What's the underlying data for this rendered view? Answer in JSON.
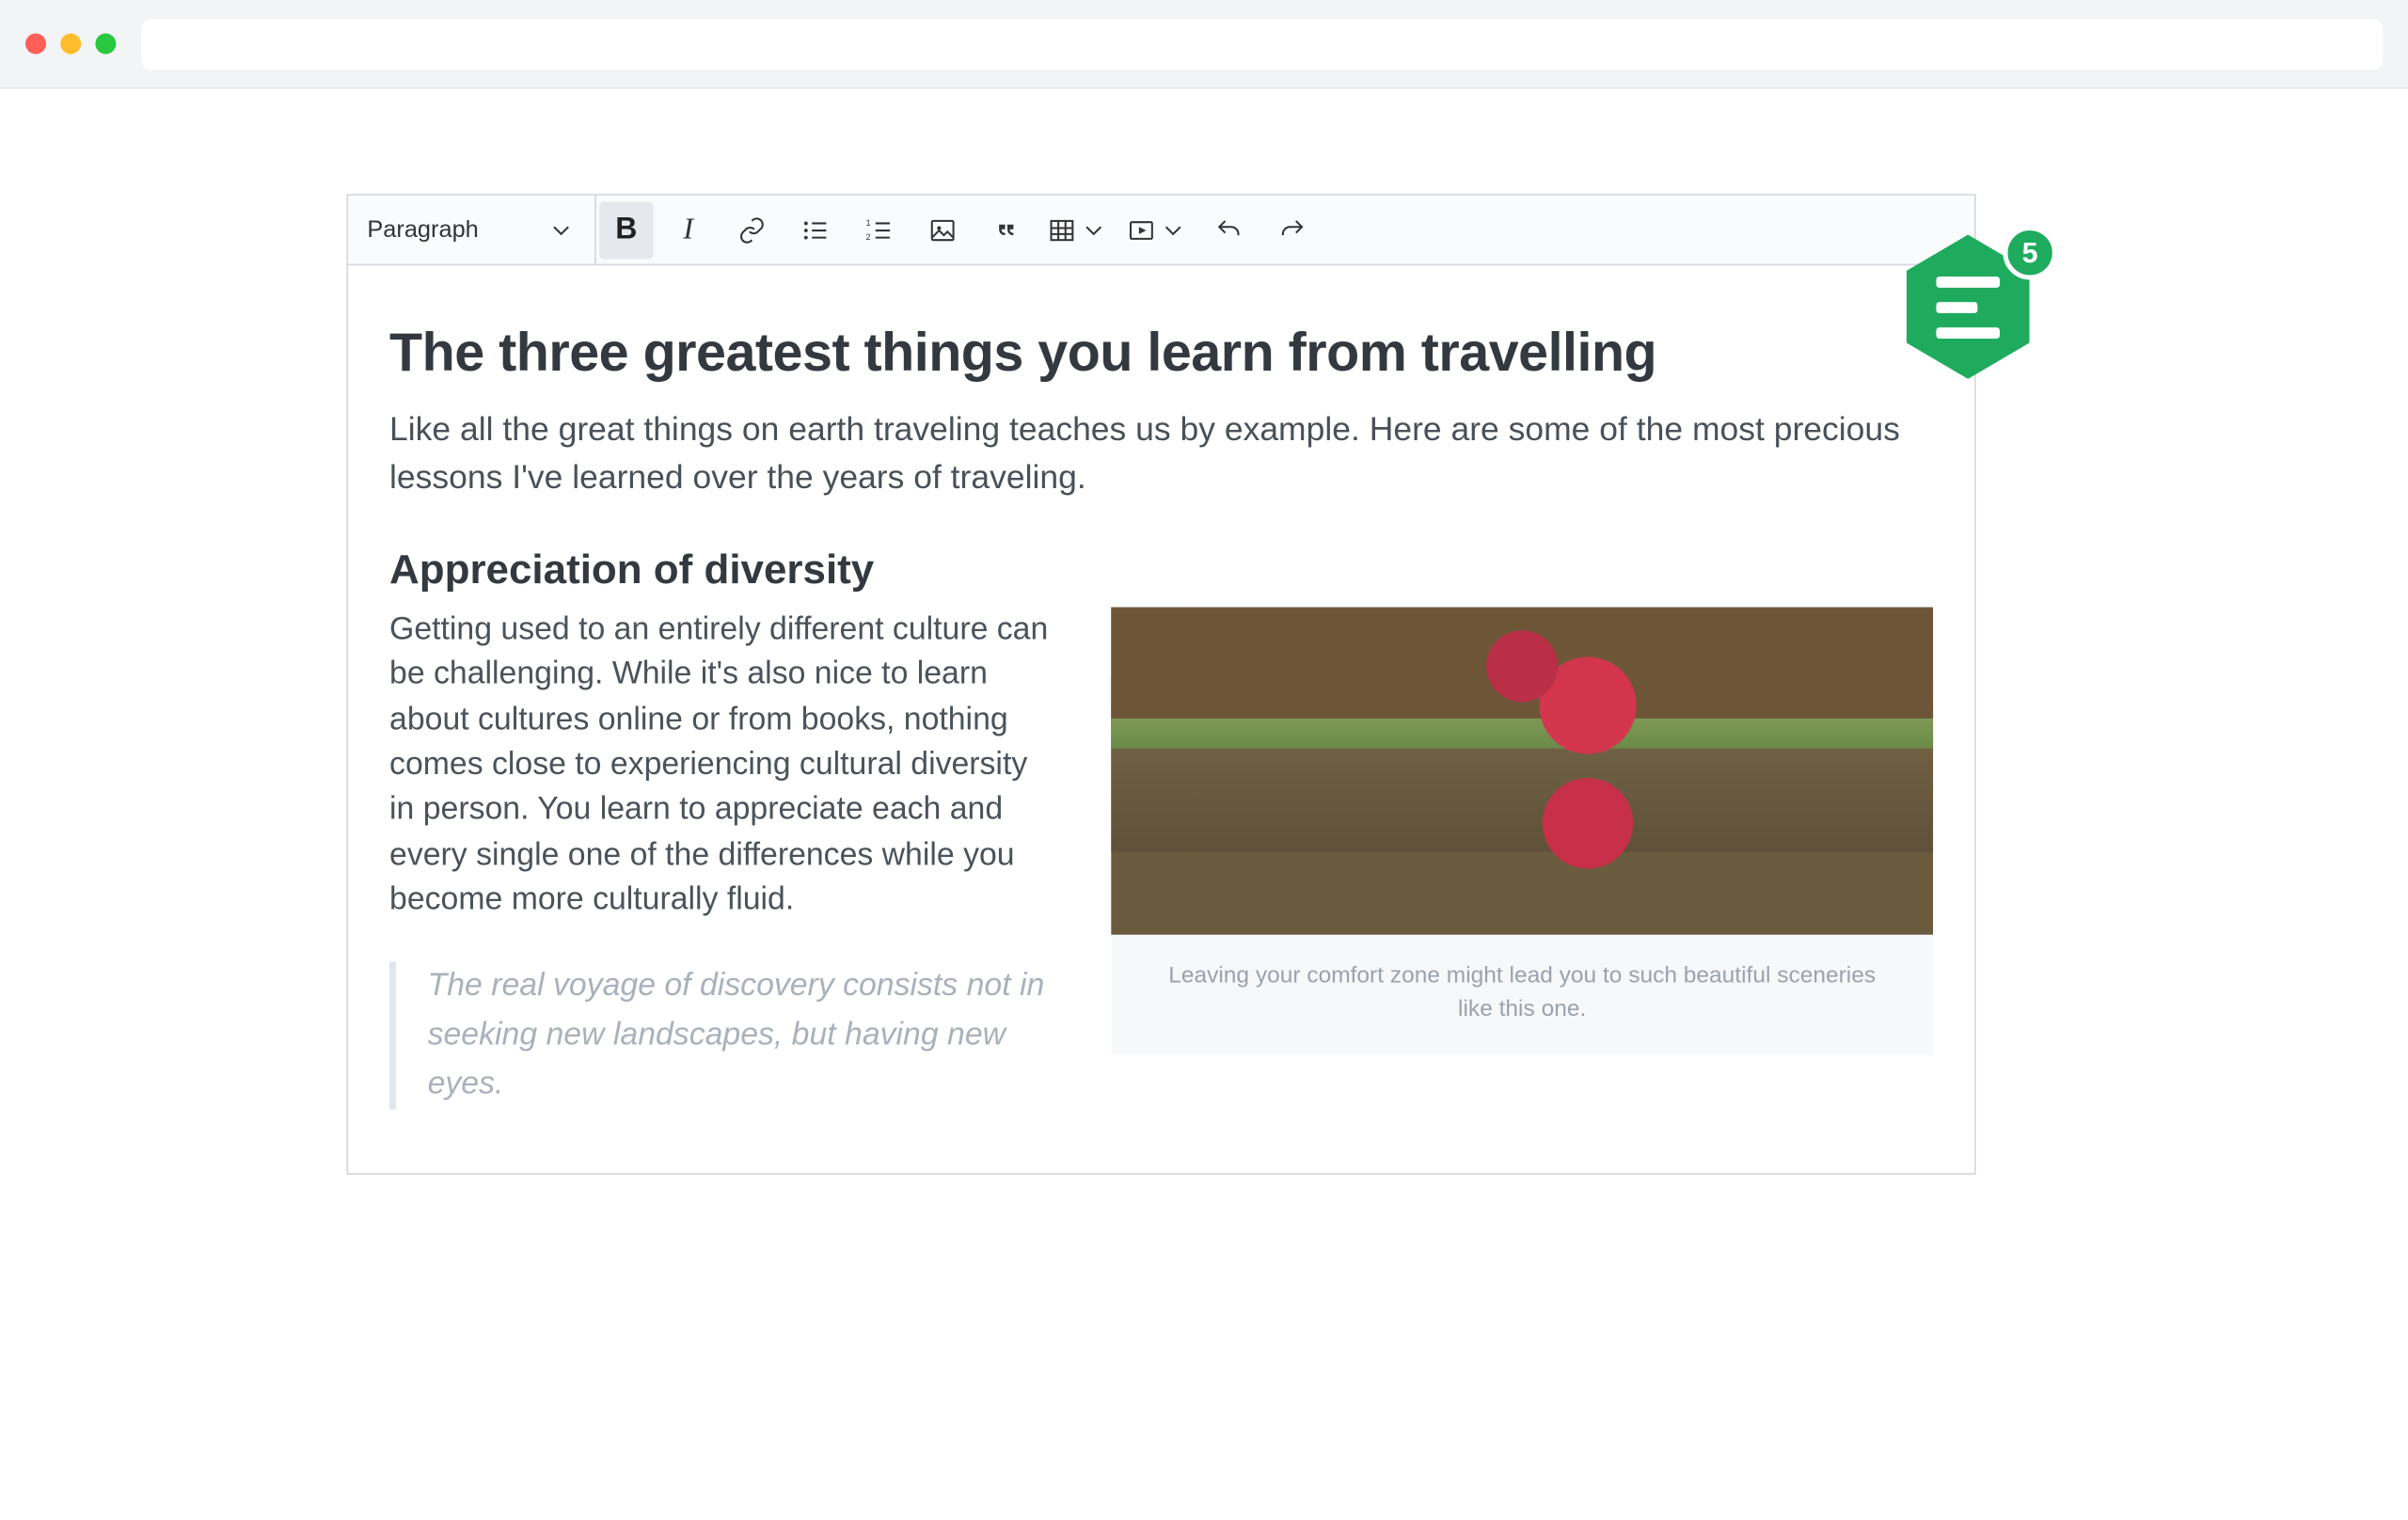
{
  "toolbar": {
    "block_style": "Paragraph",
    "icons": {
      "bold": "bold-icon",
      "italic": "italic-icon",
      "link": "link-icon",
      "ul": "bulleted-list-icon",
      "ol": "numbered-list-icon",
      "image": "image-icon",
      "quote": "blockquote-icon",
      "table": "table-icon",
      "media": "media-icon",
      "undo": "undo-icon",
      "redo": "redo-icon"
    }
  },
  "document": {
    "title": "The three greatest things you learn from travelling",
    "lead": "Like all the great things on earth traveling teaches us by example. Here are some of the most precious lessons I've learned over the years of traveling.",
    "section_heading": "Appreciation of diversity",
    "body": "Getting used to an entirely different culture can be challenging. While it's also nice to learn about cultures online or from books, nothing comes close to experiencing cultural diversity in person. You learn to appreciate each and every single one of the differences while you become more culturally fluid.",
    "quote": "The real voyage of discovery consists not in seeking new landscapes, but having new eyes.",
    "image_caption": "Leaving your comfort zone might lead you to such beautiful sceneries like this one."
  },
  "badge": {
    "count": "5",
    "color": "#1eab5d"
  }
}
